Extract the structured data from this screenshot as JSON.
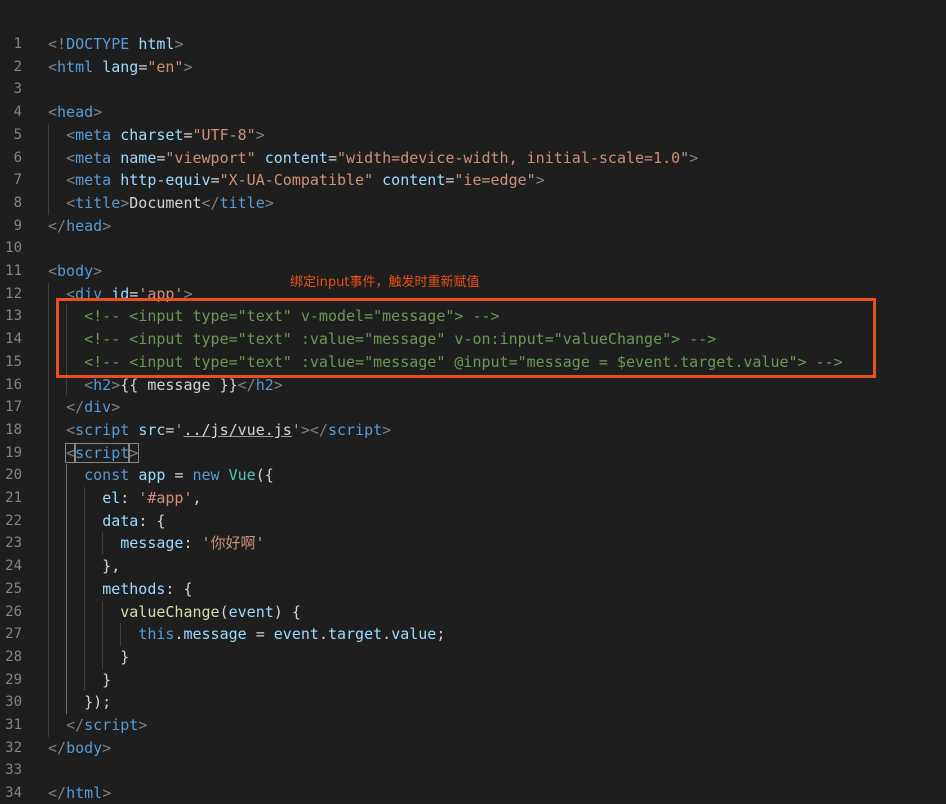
{
  "line_numbers": [
    "1",
    "2",
    "3",
    "4",
    "5",
    "6",
    "7",
    "8",
    "9",
    "10",
    "11",
    "12",
    "13",
    "14",
    "15",
    "16",
    "17",
    "18",
    "19",
    "20",
    "21",
    "22",
    "23",
    "24",
    "25",
    "26",
    "27",
    "28",
    "29",
    "30",
    "31",
    "32",
    "33",
    "34"
  ],
  "annotation": {
    "label": "绑定input事件，触发时重新赋值",
    "color": "#e8501c"
  },
  "code_lines": [
    [
      [
        "tg",
        "<!"
      ],
      [
        "tn",
        "DOCTYPE "
      ],
      [
        "at",
        "html"
      ],
      [
        "tg",
        ">"
      ]
    ],
    [
      [
        "tg",
        "<"
      ],
      [
        "tn",
        "html "
      ],
      [
        "at",
        "lang"
      ],
      [
        "pl",
        "="
      ],
      [
        "st",
        "\"en\""
      ],
      [
        "tg",
        ">"
      ]
    ],
    [],
    [
      [
        "tg",
        "<"
      ],
      [
        "tn",
        "head"
      ],
      [
        "tg",
        ">"
      ]
    ],
    [
      [
        "pl",
        "  "
      ],
      [
        "tg",
        "<"
      ],
      [
        "tn",
        "meta "
      ],
      [
        "at",
        "charset"
      ],
      [
        "pl",
        "="
      ],
      [
        "st",
        "\"UTF-8\""
      ],
      [
        "tg",
        ">"
      ]
    ],
    [
      [
        "pl",
        "  "
      ],
      [
        "tg",
        "<"
      ],
      [
        "tn",
        "meta "
      ],
      [
        "at",
        "name"
      ],
      [
        "pl",
        "="
      ],
      [
        "st",
        "\"viewport\" "
      ],
      [
        "at",
        "content"
      ],
      [
        "pl",
        "="
      ],
      [
        "st",
        "\"width=device-width, initial-scale=1.0\""
      ],
      [
        "tg",
        ">"
      ]
    ],
    [
      [
        "pl",
        "  "
      ],
      [
        "tg",
        "<"
      ],
      [
        "tn",
        "meta "
      ],
      [
        "at",
        "http-equiv"
      ],
      [
        "pl",
        "="
      ],
      [
        "st",
        "\"X-UA-Compatible\" "
      ],
      [
        "at",
        "content"
      ],
      [
        "pl",
        "="
      ],
      [
        "st",
        "\"ie=edge\""
      ],
      [
        "tg",
        ">"
      ]
    ],
    [
      [
        "pl",
        "  "
      ],
      [
        "tg",
        "<"
      ],
      [
        "tn",
        "title"
      ],
      [
        "tg",
        ">"
      ],
      [
        "pl",
        "Document"
      ],
      [
        "tg",
        "</"
      ],
      [
        "tn",
        "title"
      ],
      [
        "tg",
        ">"
      ]
    ],
    [
      [
        "tg",
        "</"
      ],
      [
        "tn",
        "head"
      ],
      [
        "tg",
        ">"
      ]
    ],
    [],
    [
      [
        "tg",
        "<"
      ],
      [
        "tn",
        "body"
      ],
      [
        "tg",
        ">"
      ]
    ],
    [
      [
        "pl",
        "  "
      ],
      [
        "tg",
        "<"
      ],
      [
        "tn",
        "div "
      ],
      [
        "at",
        "id"
      ],
      [
        "pl",
        "="
      ],
      [
        "st",
        "'app'"
      ],
      [
        "tg",
        ">"
      ]
    ],
    [
      [
        "pl",
        "    "
      ],
      [
        "cm",
        "<!-- <input type=\"text\" v-model=\"message\"> -->"
      ]
    ],
    [
      [
        "pl",
        "    "
      ],
      [
        "cm",
        "<!-- <input type=\"text\" :value=\"message\" v-on:input=\"valueChange\"> -->"
      ]
    ],
    [
      [
        "pl",
        "    "
      ],
      [
        "cm",
        "<!-- <input type=\"text\" :value=\"message\" @input=\"message = $event.target.value\"> -->"
      ]
    ],
    [
      [
        "pl",
        "    "
      ],
      [
        "tg",
        "<"
      ],
      [
        "tn",
        "h2"
      ],
      [
        "tg",
        ">"
      ],
      [
        "pl",
        "{{ message }}"
      ],
      [
        "tg",
        "</"
      ],
      [
        "tn",
        "h2"
      ],
      [
        "tg",
        ">"
      ]
    ],
    [
      [
        "pl",
        "  "
      ],
      [
        "tg",
        "</"
      ],
      [
        "tn",
        "div"
      ],
      [
        "tg",
        ">"
      ]
    ],
    [
      [
        "pl",
        "  "
      ],
      [
        "tg",
        "<"
      ],
      [
        "tn",
        "script "
      ],
      [
        "at",
        "src"
      ],
      [
        "pl",
        "="
      ],
      [
        "st",
        "'"
      ],
      [
        "un",
        "../js/vue.js"
      ],
      [
        "st",
        "'"
      ],
      [
        "tg",
        "></"
      ],
      [
        "tn",
        "script"
      ],
      [
        "tg",
        ">"
      ]
    ],
    [
      [
        "pl",
        "  "
      ],
      [
        "mtg",
        "<"
      ],
      [
        "mtn",
        "script"
      ],
      [
        "mtg",
        ">"
      ]
    ],
    [
      [
        "pl",
        "    "
      ],
      [
        "kw",
        "const "
      ],
      [
        "vr",
        "app "
      ],
      [
        "pl",
        "= "
      ],
      [
        "kw",
        "new "
      ],
      [
        "cl",
        "Vue"
      ],
      [
        "pl",
        "({"
      ]
    ],
    [
      [
        "pl",
        "      "
      ],
      [
        "vr",
        "el"
      ],
      [
        "pl",
        ": "
      ],
      [
        "st",
        "'#app'"
      ],
      [
        "pl",
        ","
      ]
    ],
    [
      [
        "pl",
        "      "
      ],
      [
        "vr",
        "data"
      ],
      [
        "pl",
        ": {"
      ]
    ],
    [
      [
        "pl",
        "        "
      ],
      [
        "vr",
        "message"
      ],
      [
        "pl",
        ": "
      ],
      [
        "st",
        "'你好啊'"
      ]
    ],
    [
      [
        "pl",
        "      },"
      ]
    ],
    [
      [
        "pl",
        "      "
      ],
      [
        "vr",
        "methods"
      ],
      [
        "pl",
        ": {"
      ]
    ],
    [
      [
        "pl",
        "        "
      ],
      [
        "fn",
        "valueChange"
      ],
      [
        "pl",
        "("
      ],
      [
        "vr",
        "event"
      ],
      [
        "pl",
        ") {"
      ]
    ],
    [
      [
        "pl",
        "          "
      ],
      [
        "kw",
        "this"
      ],
      [
        "pl",
        "."
      ],
      [
        "vr",
        "message "
      ],
      [
        "pl",
        "= "
      ],
      [
        "vr",
        "event"
      ],
      [
        "pl",
        "."
      ],
      [
        "vr",
        "target"
      ],
      [
        "pl",
        "."
      ],
      [
        "vr",
        "value"
      ],
      [
        "pl",
        ";"
      ]
    ],
    [
      [
        "pl",
        "        }"
      ]
    ],
    [
      [
        "pl",
        "      }"
      ]
    ],
    [
      [
        "pl",
        "    });"
      ]
    ],
    [
      [
        "pl",
        "  "
      ],
      [
        "tg",
        "</"
      ],
      [
        "tn",
        "script"
      ],
      [
        "tg",
        ">"
      ]
    ],
    [
      [
        "tg",
        "</"
      ],
      [
        "tn",
        "body"
      ],
      [
        "tg",
        ">"
      ]
    ],
    [],
    [
      [
        "tg",
        "</"
      ],
      [
        "tn",
        "html"
      ],
      [
        "tg",
        ">"
      ]
    ]
  ]
}
